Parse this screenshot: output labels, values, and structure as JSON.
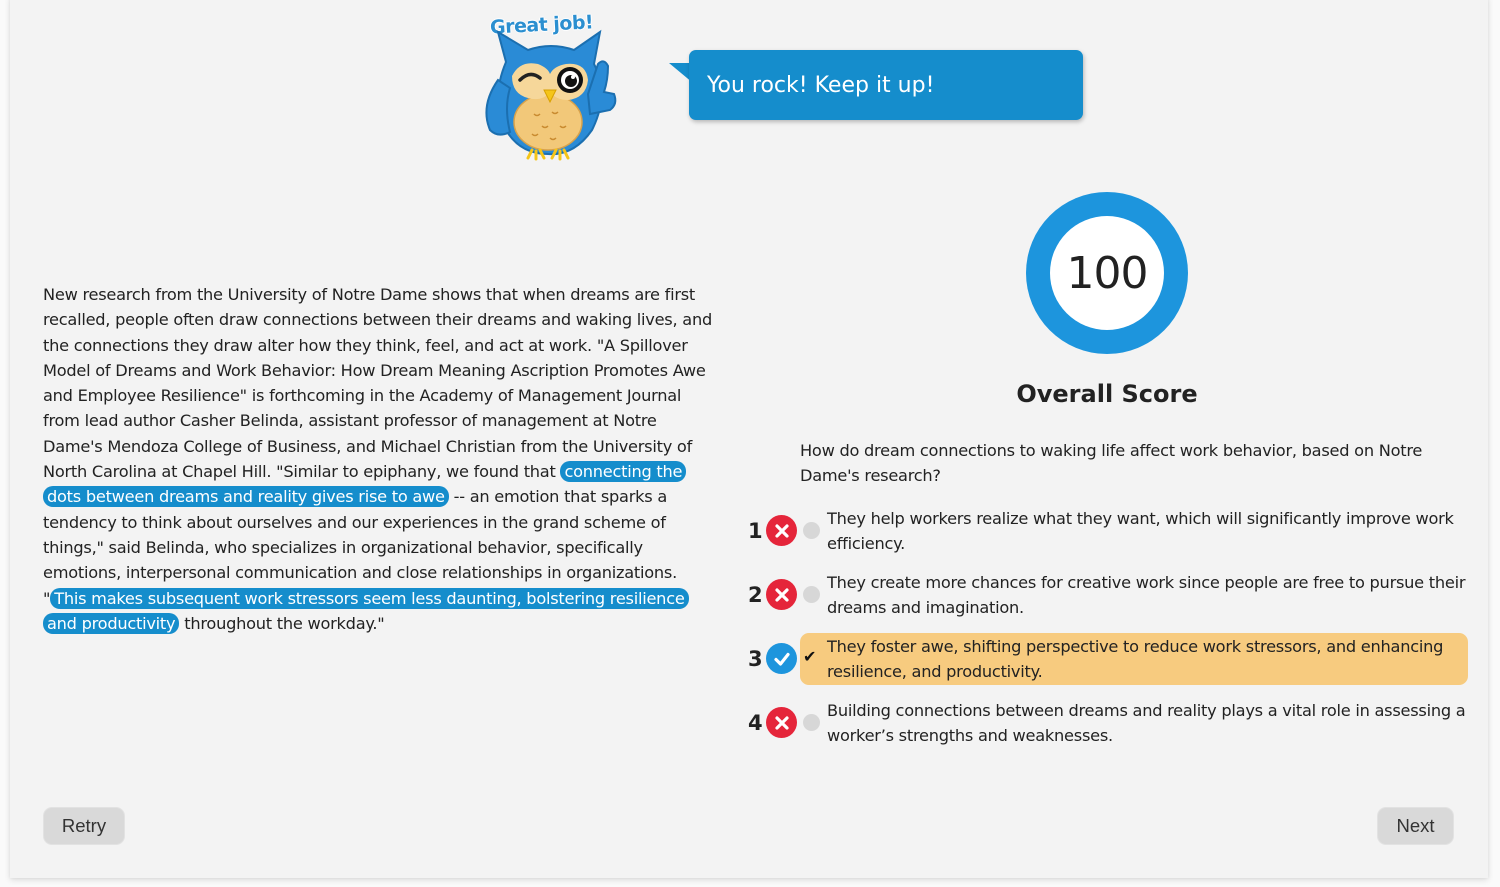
{
  "feedback": {
    "mascot_caption": "Great job!",
    "message": "You rock! Keep it up!"
  },
  "passage": {
    "segments": [
      {
        "text": "New research from the University of Notre Dame shows that when dreams are first recalled, people often draw connections between their dreams and waking lives, and the connections they draw alter how they think, feel, and act at work. \"A Spillover Model of Dreams and Work Behavior: How Dream Meaning Ascription Promotes Awe and Employee Resilience\" is forthcoming in the Academy of Management Journal from lead author Casher Belinda, assistant professor of management at Notre Dame's Mendoza College of Business, and Michael Christian from the University of North Carolina at Chapel Hill. \"Similar to epiphany, we found that ",
        "highlight": false
      },
      {
        "text": "connecting the dots between dreams and reality gives rise to awe",
        "highlight": true
      },
      {
        "text": " -- an emotion that sparks a tendency to think about ourselves and our experiences in the grand scheme of things,\" said Belinda, who specializes in organizational behavior, specifically emotions, interpersonal communication and close relationships in organizations. \"",
        "highlight": false
      },
      {
        "text": "This makes subsequent work stressors seem less daunting, bolstering resilience and productivity",
        "highlight": true
      },
      {
        "text": " throughout the workday.\"",
        "highlight": false
      }
    ]
  },
  "score": {
    "value": "100",
    "label": "Overall Score",
    "fraction": 1.0,
    "ring_color": "#1d95dd"
  },
  "quiz": {
    "question": "How do dream connections to waking life affect work behavior, based on Notre Dame's research?",
    "options": [
      {
        "number": "1",
        "text": "They help workers realize what they want, which will significantly improve work efficiency.",
        "correct": false,
        "selected": false,
        "status_icon": "x-circle-icon"
      },
      {
        "number": "2",
        "text": "They create more chances for creative work since people are free to pursue their dreams and imagination.",
        "correct": false,
        "selected": false,
        "status_icon": "x-circle-icon"
      },
      {
        "number": "3",
        "text": "They foster awe, shifting perspective to reduce work stressors, and enhancing resilience, and productivity.",
        "correct": true,
        "selected": true,
        "status_icon": "check-circle-icon"
      },
      {
        "number": "4",
        "text": "Building connections between dreams and reality plays a vital role in assessing a worker’s strengths and weaknesses.",
        "correct": false,
        "selected": false,
        "status_icon": "x-circle-icon"
      }
    ]
  },
  "buttons": {
    "retry": "Retry",
    "next": "Next"
  },
  "colors": {
    "accent": "#158dcc",
    "wrong": "#e5253a",
    "selected_bg": "#f7cb7f"
  }
}
